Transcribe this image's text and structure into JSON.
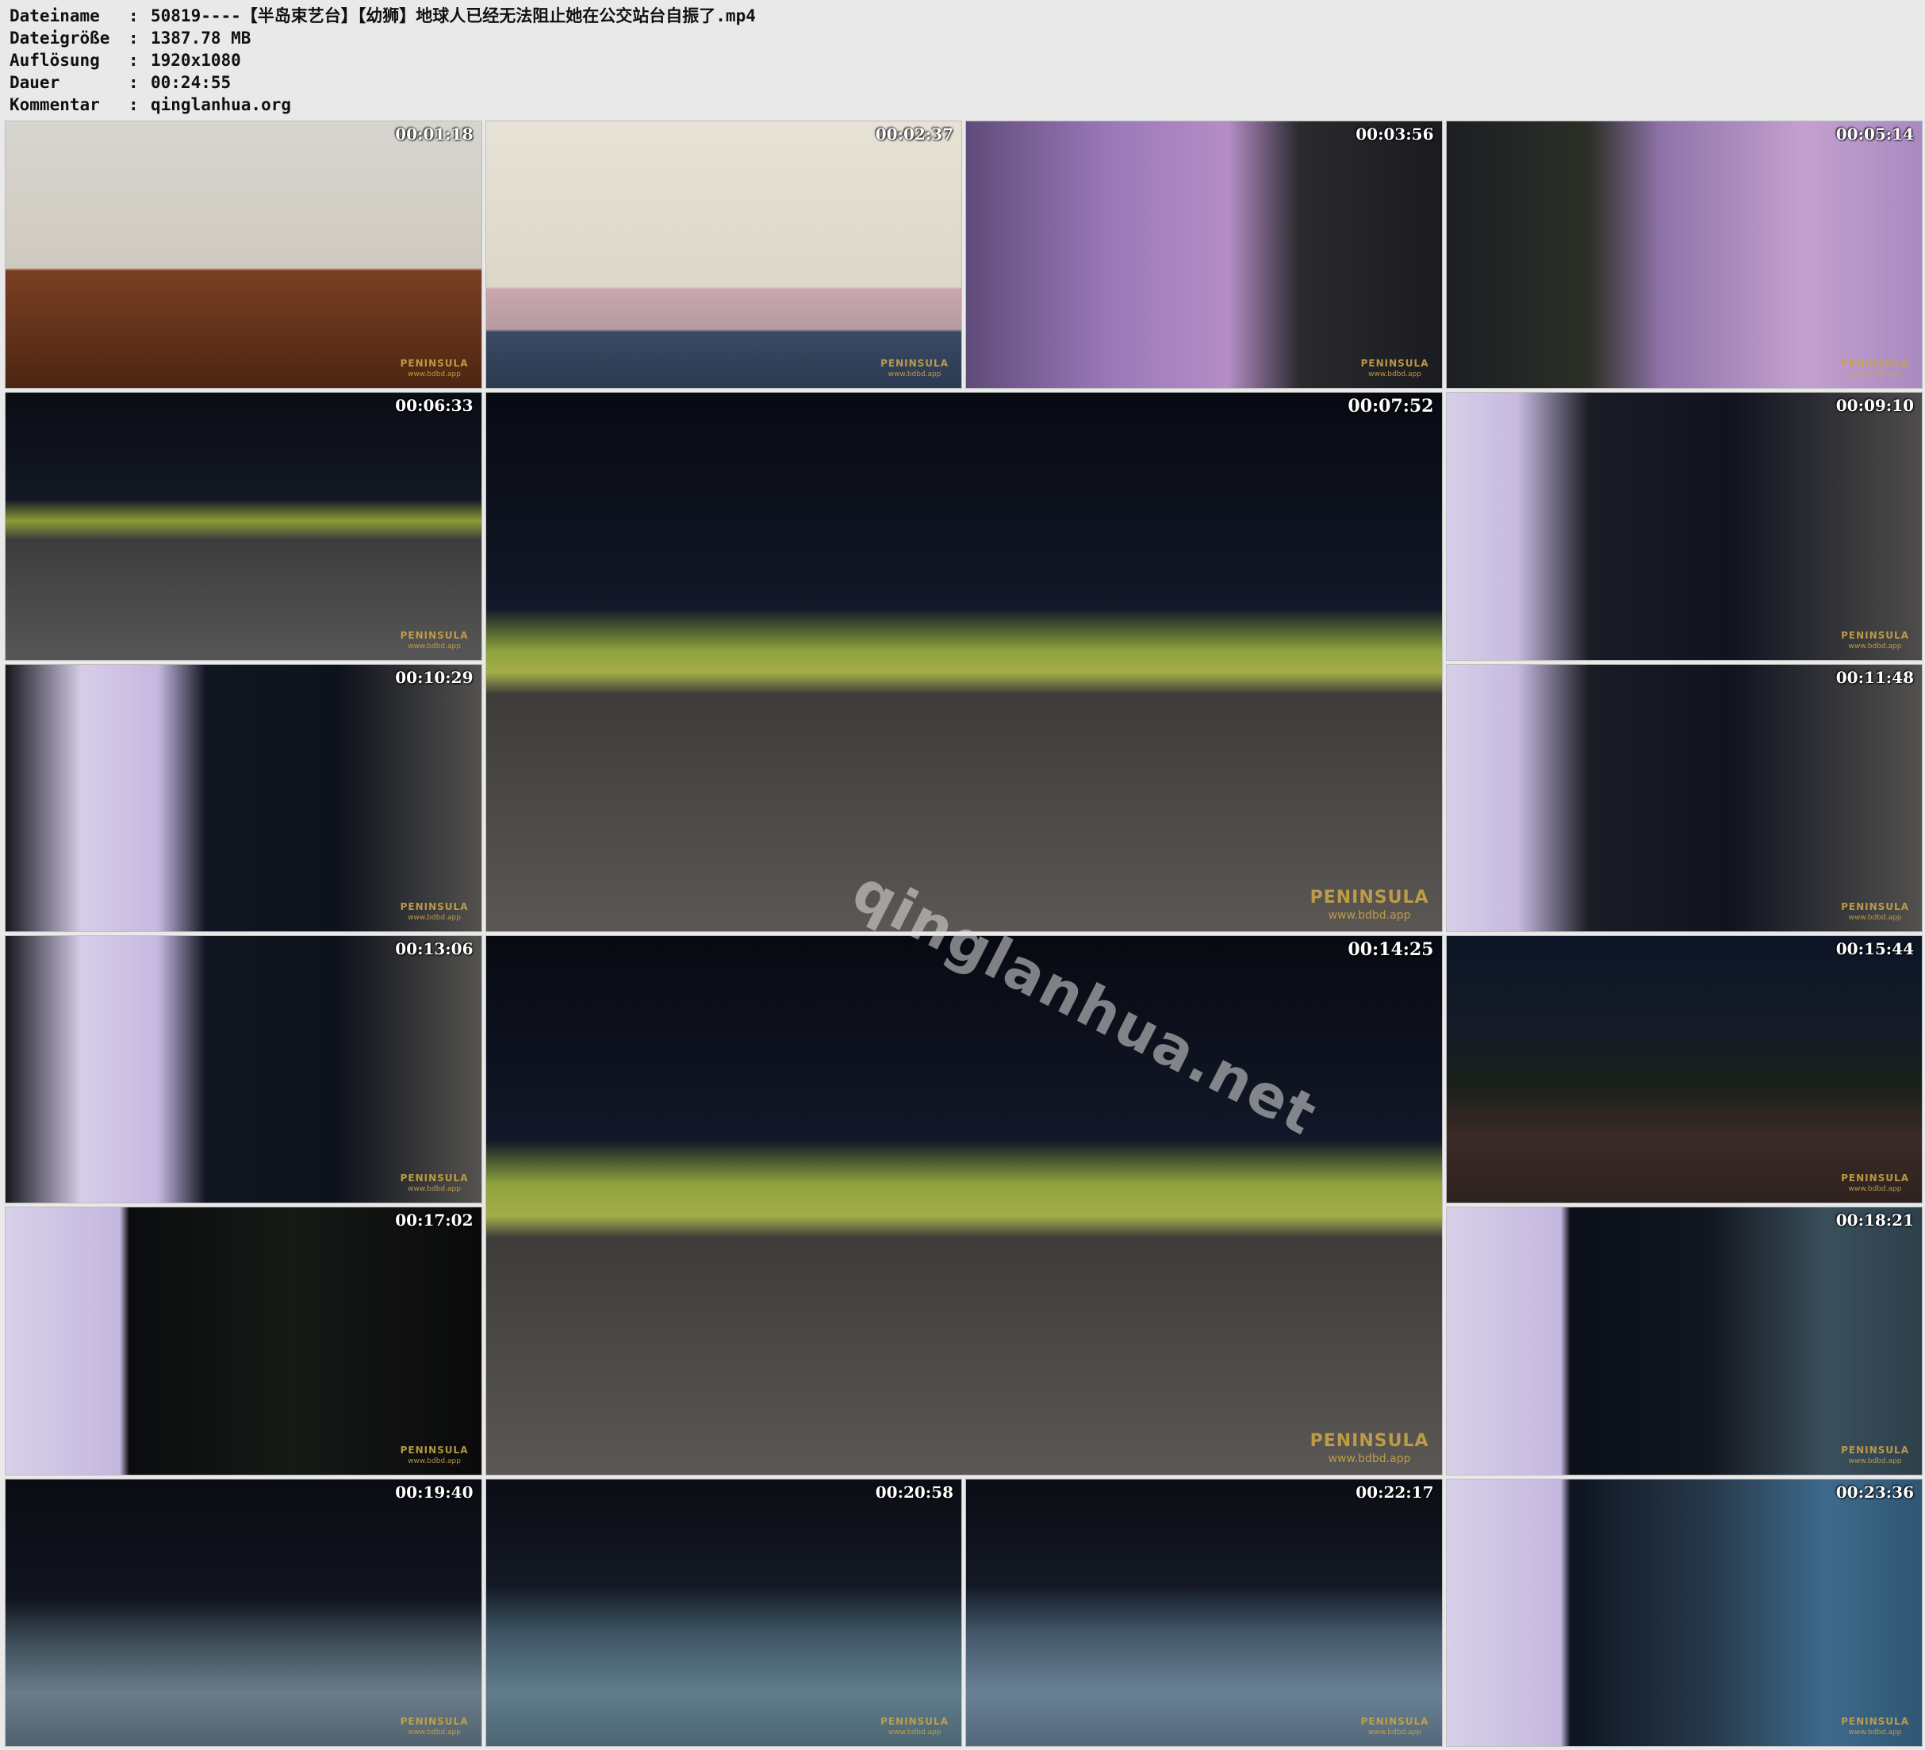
{
  "file_info": [
    {
      "label": "Dateiname",
      "value": "50819----【半岛束艺台】【幼狮】地球人已经无法阻止她在公交站台自振了.mp4"
    },
    {
      "label": "Dateigröße",
      "value": "1387.78 MB"
    },
    {
      "label": "Auflösung",
      "value": "1920x1080"
    },
    {
      "label": "Dauer",
      "value": "00:24:55"
    },
    {
      "label": "Kommentar",
      "value": "qinglanhua.org"
    }
  ],
  "separator": ":",
  "thumbnails": [
    {
      "timestamp": "00:01:18"
    },
    {
      "timestamp": "00:02:37"
    },
    {
      "timestamp": "00:03:56"
    },
    {
      "timestamp": "00:05:14"
    },
    {
      "timestamp": "00:06:33"
    },
    {
      "timestamp": "00:07:52"
    },
    {
      "timestamp": "00:09:10"
    },
    {
      "timestamp": "00:10:29"
    },
    {
      "timestamp": "00:11:48"
    },
    {
      "timestamp": "00:13:06"
    },
    {
      "timestamp": "00:14:25"
    },
    {
      "timestamp": "00:15:44"
    },
    {
      "timestamp": "00:17:02"
    },
    {
      "timestamp": "00:18:21"
    },
    {
      "timestamp": "00:19:40"
    },
    {
      "timestamp": "00:20:58"
    },
    {
      "timestamp": "00:22:17"
    },
    {
      "timestamp": "00:23:36"
    }
  ],
  "overlay_watermark": {
    "brand": "PENINSULA",
    "url": "www.bdbd.app"
  },
  "site_watermark": "qinglanhua.net"
}
